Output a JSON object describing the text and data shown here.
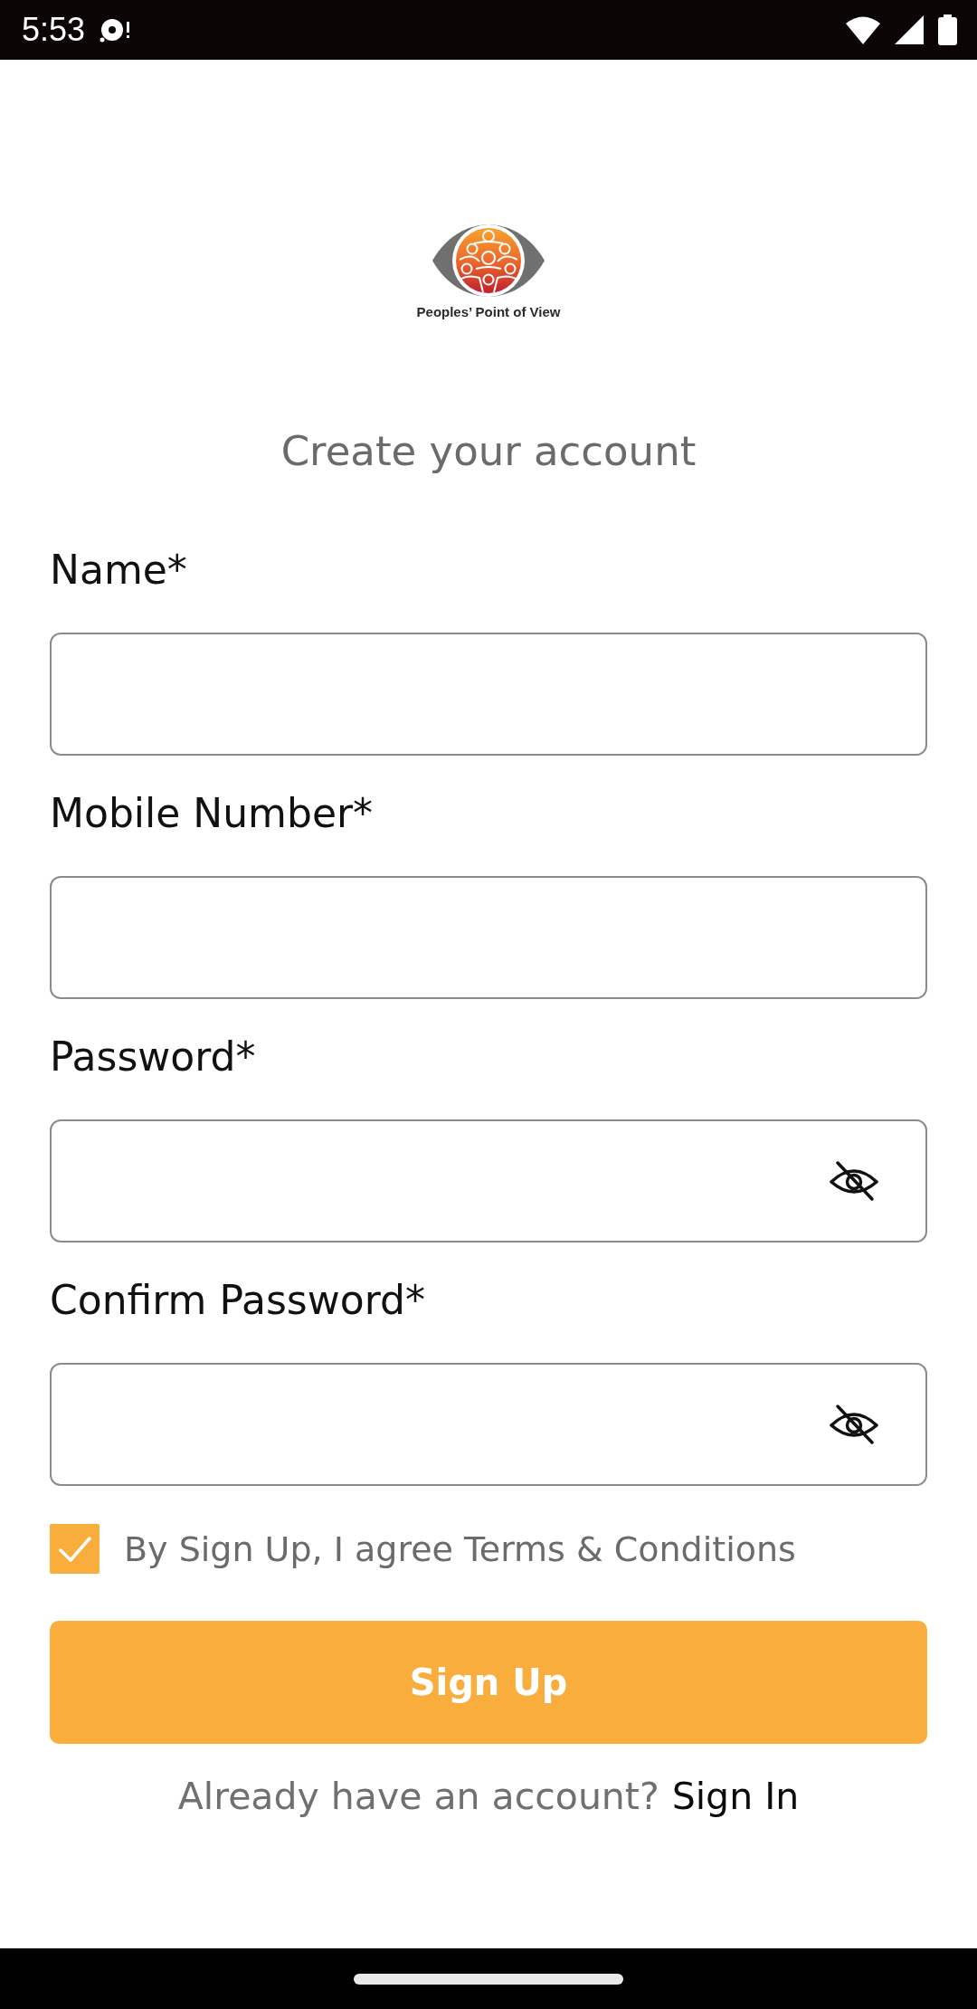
{
  "status_bar": {
    "time": "5:53"
  },
  "logo": {
    "caption": "Peoples’ Point of View"
  },
  "title": "Create your account",
  "fields": [
    {
      "label": "Name*",
      "kind": "text"
    },
    {
      "label": "Mobile Number*",
      "kind": "text"
    },
    {
      "label": "Password*",
      "kind": "password",
      "revealed": false
    },
    {
      "label": "Confirm Password*",
      "kind": "password",
      "revealed": false
    }
  ],
  "terms": {
    "checked": true,
    "text": "By Sign Up, I agree Terms & Conditions"
  },
  "submit_button": "Sign Up",
  "footer": {
    "prompt": "Already have an account?",
    "link": "Sign In"
  }
}
